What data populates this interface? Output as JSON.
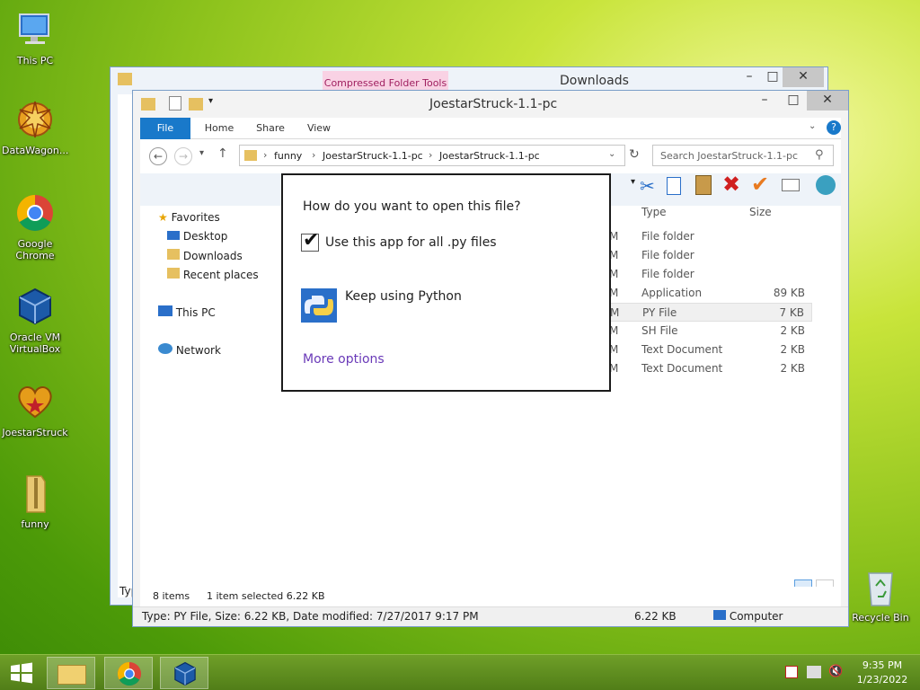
{
  "desktop": {
    "icons": [
      {
        "label": "This PC",
        "icon": "computer-icon"
      },
      {
        "label": "DataWagon...",
        "icon": "datawagon-icon"
      },
      {
        "label": "Google Chrome",
        "icon": "chrome-icon"
      },
      {
        "label": "Oracle VM VirtualBox",
        "icon": "virtualbox-icon"
      },
      {
        "label": "JoestarStruck",
        "icon": "heart-icon"
      },
      {
        "label": "funny",
        "icon": "zip-folder-icon"
      }
    ],
    "recycle_bin": "Recycle Bin"
  },
  "back_window": {
    "title": "Downloads",
    "context_tab": "Compressed Folder Tools",
    "status_fragment": "6",
    "status_fragment2": "Typ"
  },
  "window": {
    "title": "JoestarStruck-1.1-pc",
    "tabs": [
      "File",
      "Home",
      "Share",
      "View"
    ],
    "breadcrumb": [
      "funny",
      "JoestarStruck-1.1-pc",
      "JoestarStruck-1.1-pc"
    ],
    "search_placeholder": "Search JoestarStruck-1.1-pc",
    "nav": {
      "favorites": "Favorites",
      "desktop": "Desktop",
      "downloads": "Downloads",
      "recent": "Recent places",
      "thispc": "This PC",
      "network": "Network"
    },
    "columns": {
      "type": "Type",
      "size": "Size"
    },
    "files": [
      {
        "type": "File folder",
        "size": ""
      },
      {
        "type": "File folder",
        "size": ""
      },
      {
        "type": "File folder",
        "size": ""
      },
      {
        "type": "Application",
        "size": "89 KB"
      },
      {
        "type": "PY File",
        "size": "7 KB"
      },
      {
        "type": "SH File",
        "size": "2 KB"
      },
      {
        "type": "Text Document",
        "size": "2 KB"
      },
      {
        "type": "Text Document",
        "size": "2 KB"
      }
    ],
    "status": {
      "items": "8 items",
      "selected": "1 item selected  6.22 KB"
    },
    "details": {
      "info": "Type: PY File, Size: 6.22 KB, Date modified: 7/27/2017 9:17 PM",
      "size": "6.22 KB",
      "location": "Computer"
    }
  },
  "dialog": {
    "question": "How do you want to open this file?",
    "checkbox_label": "Use this app for all .py files",
    "checkbox_checked": true,
    "app_option": "Keep using Python",
    "more_options": "More options"
  },
  "taskbar": {
    "time": "9:35 PM",
    "date": "1/23/2022"
  }
}
